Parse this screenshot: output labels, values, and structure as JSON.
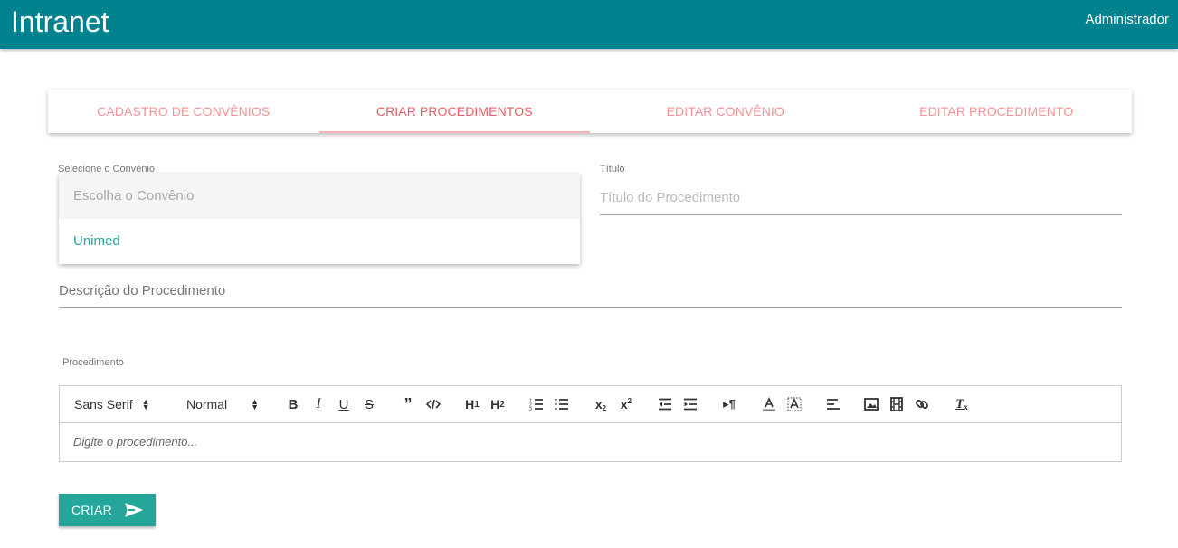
{
  "header": {
    "title": "Intranet",
    "user": "Administrador"
  },
  "tabs": [
    {
      "label": "CADASTRO DE CONVÊNIOS",
      "active": false
    },
    {
      "label": "CRIAR PROCEDIMENTOS",
      "active": true
    },
    {
      "label": "EDITAR CONVÊNIO",
      "active": false
    },
    {
      "label": "EDITAR PROCEDIMENTO",
      "active": false
    }
  ],
  "form": {
    "convenio_label": "Selecione o Convênio",
    "convenio_options": [
      "Escolha o Convênio",
      "Unimed"
    ],
    "titulo_label": "Título",
    "titulo_placeholder": "Título do Procedimento",
    "descricao_placeholder": "Descrição do Procedimento",
    "procedimento_label": "Procedimento"
  },
  "editor": {
    "font_picker": "Sans Serif",
    "size_picker": "Normal",
    "placeholder": "Digite o procedimento..."
  },
  "button": {
    "label": "CRIAR",
    "icon": "send-icon"
  },
  "colors": {
    "topbar": "#00838f",
    "accent": "#26a69a",
    "tab_text": "#ee6e73"
  }
}
